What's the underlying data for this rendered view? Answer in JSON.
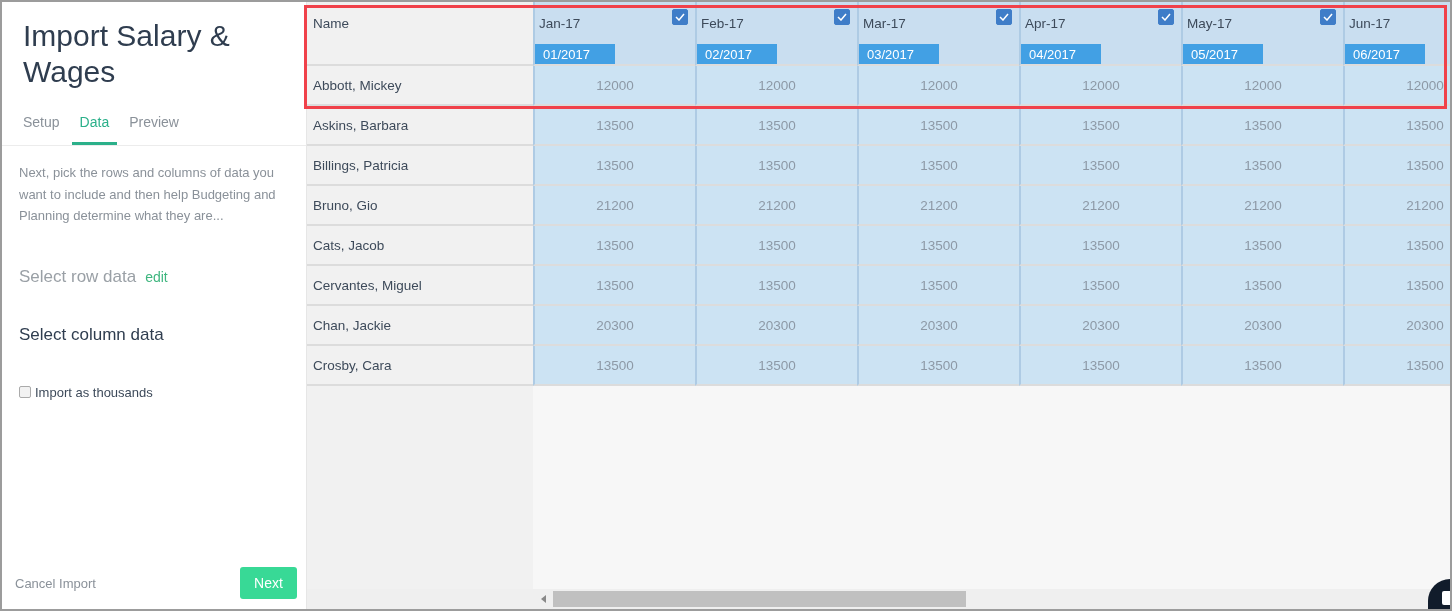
{
  "panel": {
    "title": "Import Salary & Wages",
    "tabs": [
      {
        "label": "Setup",
        "selected": false
      },
      {
        "label": "Data",
        "selected": true
      },
      {
        "label": "Preview",
        "selected": false
      }
    ],
    "description": "Next, pick the rows and columns of data you want to include and then help Budgeting and Planning determine what they are...",
    "row_step": {
      "label": "Select row data",
      "link": "edit"
    },
    "column_step": {
      "label": "Select column data"
    },
    "thousands": {
      "label": "Import as thousands",
      "checked": false
    },
    "cancel": "Cancel Import",
    "next": "Next"
  },
  "table": {
    "name_header": "Name",
    "columns": [
      {
        "label": "Jan-17",
        "checked": true,
        "period": "01/2017"
      },
      {
        "label": "Feb-17",
        "checked": true,
        "period": "02/2017"
      },
      {
        "label": "Mar-17",
        "checked": true,
        "period": "03/2017"
      },
      {
        "label": "Apr-17",
        "checked": true,
        "period": "04/2017"
      },
      {
        "label": "May-17",
        "checked": true,
        "period": "05/2017"
      },
      {
        "label": "Jun-17",
        "period": "06/2017"
      }
    ],
    "rows": [
      {
        "name": "Abbott, Mickey",
        "values": [
          "12000",
          "12000",
          "12000",
          "12000",
          "12000",
          "12000"
        ]
      },
      {
        "name": "Askins, Barbara",
        "values": [
          "13500",
          "13500",
          "13500",
          "13500",
          "13500",
          "13500"
        ]
      },
      {
        "name": "Billings, Patricia",
        "values": [
          "13500",
          "13500",
          "13500",
          "13500",
          "13500",
          "13500"
        ]
      },
      {
        "name": "Bruno, Gio",
        "values": [
          "21200",
          "21200",
          "21200",
          "21200",
          "21200",
          "21200"
        ]
      },
      {
        "name": "Cats, Jacob",
        "values": [
          "13500",
          "13500",
          "13500",
          "13500",
          "13500",
          "13500"
        ]
      },
      {
        "name": "Cervantes, Miguel",
        "values": [
          "13500",
          "13500",
          "13500",
          "13500",
          "13500",
          "13500"
        ]
      },
      {
        "name": "Chan, Jackie",
        "values": [
          "20300",
          "20300",
          "20300",
          "20300",
          "20300",
          "20300"
        ]
      },
      {
        "name": "Crosby, Cara",
        "values": [
          "13500",
          "13500",
          "13500",
          "13500",
          "13500",
          "13500"
        ]
      }
    ]
  }
}
